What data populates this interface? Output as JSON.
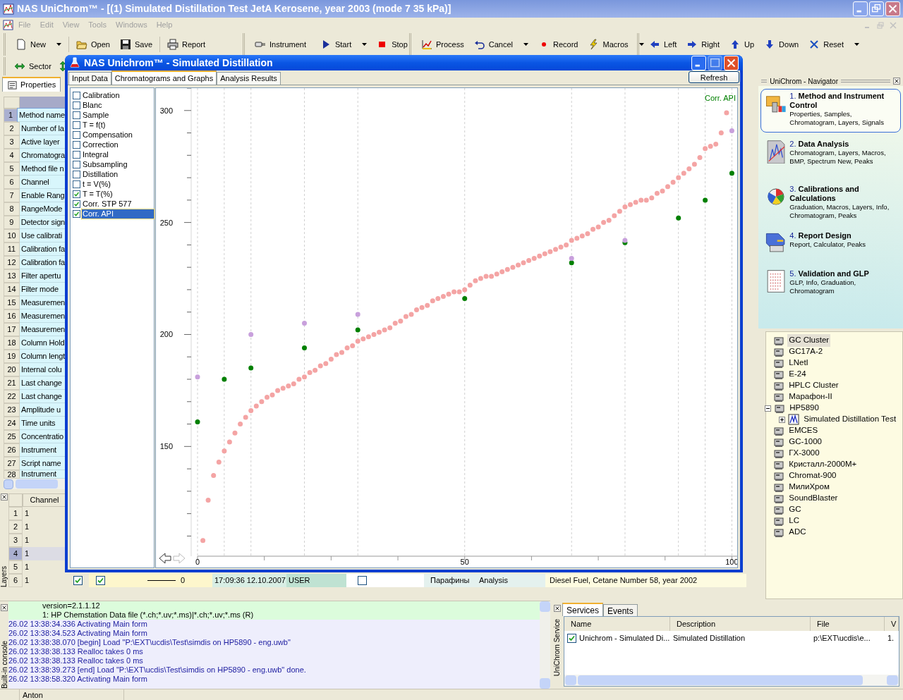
{
  "window": {
    "title": "NAS UniChrom™ - [(1) Simulated Distillation Test JetA Kerosene, year 2003 (mode 7 35 kPa)]"
  },
  "menu": [
    "File",
    "Edit",
    "View",
    "Tools",
    "Windows",
    "Help"
  ],
  "toolbars": [
    [
      [
        {
          "label": "New",
          "dropdown": true
        }
      ],
      [
        {
          "label": "Open",
          "dropdown": false
        },
        {
          "label": "Save",
          "dropdown": false
        }
      ],
      [
        {
          "label": "Report",
          "dropdown": false
        }
      ]
    ],
    [
      [
        {
          "label": "Instrument",
          "dropdown": false
        }
      ],
      [
        {
          "label": "Start",
          "dropdown": true
        },
        {
          "label": "Stop",
          "dropdown": false
        }
      ]
    ],
    [
      [
        {
          "label": "Process",
          "dropdown": false
        },
        {
          "label": "Cancel",
          "dropdown": true
        },
        {
          "label": "Record",
          "dropdown": false
        },
        {
          "label": "Macros",
          "dropdown": true
        }
      ]
    ],
    [
      [
        {
          "label": "Left",
          "dropdown": false
        },
        {
          "label": "Right",
          "dropdown": false
        },
        {
          "label": "Up",
          "dropdown": false
        },
        {
          "label": "Down",
          "dropdown": false
        },
        {
          "label": "Reset",
          "dropdown": true
        }
      ]
    ]
  ],
  "toolbar_2": [
    {
      "label": "Sector"
    }
  ],
  "properties_panel": {
    "tab": "Properties",
    "rows": [
      {
        "number": "1",
        "name": "Method name",
        "selected": true
      },
      {
        "number": "2",
        "name": "Number of la",
        "selected": false
      },
      {
        "number": "3",
        "name": "Active layer",
        "selected": false
      },
      {
        "number": "4",
        "name": "Chromatogra",
        "selected": false
      },
      {
        "number": "5",
        "name": "Method file n",
        "selected": false
      },
      {
        "number": "6",
        "name": "Channel",
        "selected": false
      },
      {
        "number": "7",
        "name": "Enable Rang",
        "selected": false
      },
      {
        "number": "8",
        "name": "RangeMode",
        "selected": false
      },
      {
        "number": "9",
        "name": "Detector sign",
        "selected": false
      },
      {
        "number": "10",
        "name": "Use calibrati",
        "selected": false
      },
      {
        "number": "11",
        "name": "Calibration fa",
        "selected": false
      },
      {
        "number": "12",
        "name": "Calibration fa",
        "selected": false
      },
      {
        "number": "13",
        "name": "Filter apertu",
        "selected": false
      },
      {
        "number": "14",
        "name": "Filter mode",
        "selected": false
      },
      {
        "number": "15",
        "name": "Measuremen",
        "selected": false
      },
      {
        "number": "16",
        "name": "Measuremen",
        "selected": false
      },
      {
        "number": "17",
        "name": "Measuremen",
        "selected": false
      },
      {
        "number": "18",
        "name": "Column Hold",
        "selected": false
      },
      {
        "number": "19",
        "name": "Column lengt",
        "selected": false
      },
      {
        "number": "20",
        "name": "Internal colu",
        "selected": false
      },
      {
        "number": "21",
        "name": "Last change",
        "selected": false
      },
      {
        "number": "22",
        "name": "Last change",
        "selected": false
      },
      {
        "number": "23",
        "name": "Amplitude u",
        "selected": false
      },
      {
        "number": "24",
        "name": "Time units",
        "selected": false
      },
      {
        "number": "25",
        "name": "Concentratio",
        "selected": false
      },
      {
        "number": "26",
        "name": "Instrument",
        "selected": false
      },
      {
        "number": "27",
        "name": "Script name",
        "selected": false
      },
      {
        "number": "28",
        "name": "Instrument",
        "selected": false
      }
    ]
  },
  "layers": {
    "label": "Layers",
    "column": "Channel",
    "rows": [
      {
        "number": "1",
        "channel": "1",
        "selected": false
      },
      {
        "number": "2",
        "channel": "1",
        "selected": false
      },
      {
        "number": "3",
        "channel": "1",
        "selected": false
      },
      {
        "number": "4",
        "channel": "1",
        "selected": true
      },
      {
        "number": "5",
        "channel": "1",
        "selected": false
      },
      {
        "number": "6",
        "channel": "1",
        "selected": false
      }
    ],
    "row_6_details": {
      "checks": [
        true,
        true
      ],
      "line_value": "0",
      "date": "17:09:36 12.10.2007",
      "user": "USER",
      "flag": false,
      "group": "Парафины",
      "type": "Analysis",
      "description": "Diesel Fuel, Cetane Number 58, year 2002"
    }
  },
  "child_window": {
    "title": "NAS Unichrom™ - Simulated Distillation",
    "tabs": [
      {
        "label": "Input Data",
        "selected": false
      },
      {
        "label": "Chromatograms and Graphs",
        "selected": true
      },
      {
        "label": "Analysis Results",
        "selected": false
      }
    ],
    "refresh_button": "Refresh",
    "graph_list": [
      {
        "label": "Calibration",
        "checked": false,
        "selected": false
      },
      {
        "label": "Blanc",
        "checked": false,
        "selected": false
      },
      {
        "label": "Sample",
        "checked": false,
        "selected": false
      },
      {
        "label": "T = f(t)",
        "checked": false,
        "selected": false
      },
      {
        "label": "Compensation",
        "checked": false,
        "selected": false
      },
      {
        "label": "Correction",
        "checked": false,
        "selected": false
      },
      {
        "label": "Integral",
        "checked": false,
        "selected": false
      },
      {
        "label": "Subsampling",
        "checked": false,
        "selected": false
      },
      {
        "label": "Distillation",
        "checked": false,
        "selected": false
      },
      {
        "label": "t = V(%)",
        "checked": false,
        "selected": false
      },
      {
        "label": "T = T(%)",
        "checked": true,
        "selected": false
      },
      {
        "label": "Corr. STP 577",
        "checked": true,
        "selected": false
      },
      {
        "label": "Corr. API",
        "checked": true,
        "selected": true
      }
    ],
    "chart_data": {
      "type": "scatter",
      "xlim": [
        0,
        101
      ],
      "ylim": [
        101,
        310
      ],
      "xticks": [
        0,
        50,
        100
      ],
      "yticks": [
        150,
        200,
        250,
        300
      ],
      "x": [
        0,
        1,
        2,
        3,
        4,
        5,
        6,
        7,
        8,
        9,
        10,
        11,
        12,
        13,
        14,
        15,
        16,
        17,
        18,
        19,
        20,
        21,
        22,
        23,
        24,
        25,
        26,
        27,
        28,
        29,
        30,
        31,
        32,
        33,
        34,
        35,
        36,
        37,
        38,
        39,
        40,
        41,
        42,
        43,
        44,
        45,
        46,
        47,
        48,
        49,
        50,
        51,
        52,
        53,
        54,
        55,
        56,
        57,
        58,
        59,
        60,
        61,
        62,
        63,
        64,
        65,
        66,
        67,
        68,
        69,
        70,
        71,
        72,
        73,
        74,
        75,
        76,
        77,
        78,
        79,
        80,
        81,
        82,
        83,
        84,
        85,
        86,
        87,
        88,
        89,
        90,
        91,
        92,
        93,
        94,
        95,
        96,
        97,
        98,
        99,
        100
      ],
      "series": [
        {
          "color": "#f4a4a4",
          "values": [
            null,
            108,
            126,
            137,
            143,
            148,
            152,
            156,
            160,
            163,
            166,
            168,
            170,
            172,
            173,
            175,
            176,
            177,
            178,
            180,
            181,
            183,
            184,
            186,
            187,
            189,
            191,
            192,
            194,
            195,
            197,
            198,
            199,
            200,
            201,
            202,
            203,
            205,
            206,
            208,
            209,
            211,
            212,
            213,
            215,
            216,
            217,
            218,
            219,
            219,
            220,
            222,
            224,
            225,
            226,
            226,
            227,
            228,
            229,
            230,
            231,
            232,
            233,
            234,
            235,
            236,
            237,
            238,
            239,
            240,
            242,
            243,
            244,
            245,
            247,
            248,
            250,
            251,
            253,
            255,
            257,
            258,
            259,
            260,
            260,
            261,
            263,
            264,
            266,
            268,
            270,
            272,
            274,
            276,
            279,
            283,
            284,
            285,
            290,
            299,
            null
          ]
        },
        {
          "name": "Corr. API",
          "color": "#008000",
          "values": [
            161,
            null,
            null,
            null,
            null,
            180,
            null,
            null,
            null,
            null,
            185,
            null,
            null,
            null,
            null,
            null,
            null,
            null,
            null,
            null,
            194,
            null,
            null,
            null,
            null,
            null,
            null,
            null,
            null,
            null,
            202,
            null,
            null,
            null,
            null,
            null,
            null,
            null,
            null,
            null,
            null,
            null,
            null,
            null,
            null,
            null,
            null,
            null,
            null,
            null,
            216,
            null,
            null,
            null,
            null,
            null,
            null,
            null,
            null,
            null,
            null,
            null,
            null,
            null,
            null,
            null,
            null,
            null,
            null,
            null,
            232,
            null,
            null,
            null,
            null,
            null,
            null,
            null,
            null,
            null,
            241,
            null,
            null,
            null,
            null,
            null,
            null,
            null,
            null,
            null,
            252,
            null,
            null,
            null,
            null,
            260,
            null,
            null,
            null,
            null,
            272
          ]
        },
        {
          "color": "#c8a0dc",
          "values": [
            181,
            null,
            null,
            null,
            null,
            null,
            null,
            null,
            null,
            null,
            200,
            null,
            null,
            null,
            null,
            null,
            null,
            null,
            null,
            null,
            205,
            null,
            null,
            null,
            null,
            null,
            null,
            null,
            null,
            null,
            209,
            null,
            null,
            null,
            null,
            null,
            null,
            null,
            null,
            null,
            null,
            null,
            null,
            null,
            null,
            null,
            null,
            null,
            null,
            null,
            null,
            null,
            null,
            null,
            null,
            null,
            null,
            null,
            null,
            null,
            null,
            null,
            null,
            null,
            null,
            null,
            null,
            null,
            null,
            null,
            234,
            null,
            null,
            null,
            null,
            null,
            null,
            null,
            null,
            null,
            242,
            null,
            null,
            null,
            null,
            null,
            null,
            null,
            null,
            null,
            null,
            null,
            null,
            null,
            null,
            null,
            null,
            null,
            null,
            null,
            291
          ]
        }
      ]
    }
  },
  "navigator": {
    "title": "UniChrom - Navigator",
    "items": [
      {
        "number": "1.",
        "title": "Method and Instrument Control",
        "subtitle": "Properties, Samples, Chromatogram, Layers, Signals",
        "selected": true
      },
      {
        "number": "2.",
        "title": "Data Analysis",
        "subtitle": "Chromatogram, Layers, Macros, BMP, Spectrum New, Peaks",
        "selected": false
      },
      {
        "number": "3.",
        "title": "Calibrations and Calculations",
        "subtitle": "Graduation, Macros, Layers, Info, Chromatogram, Peaks",
        "selected": false
      },
      {
        "number": "4.",
        "title": "Report Design",
        "subtitle": "Report, Calculator, Peaks",
        "selected": false
      },
      {
        "number": "5.",
        "title": "Validation and GLP",
        "subtitle": "GLP, Info, Graduation, Chromatogram",
        "selected": false
      }
    ],
    "tree": [
      {
        "label": "GC Cluster",
        "selected": true
      },
      {
        "label": "GC17A-2",
        "selected": false
      },
      {
        "label": "LNetI",
        "selected": false
      },
      {
        "label": "E-24",
        "selected": false
      },
      {
        "label": "HPLC Cluster",
        "selected": false
      },
      {
        "label": "Марафон-II",
        "selected": false
      },
      {
        "label": "HP5890",
        "selected": false,
        "expanded": true,
        "children": [
          {
            "label": "Simulated Distillation Test",
            "selected": false,
            "expanded": false
          }
        ]
      },
      {
        "label": "EMCES",
        "selected": false
      },
      {
        "label": "GC-1000",
        "selected": false
      },
      {
        "label": "ГХ-3000",
        "selected": false
      },
      {
        "label": "Кристалл-2000М+",
        "selected": false
      },
      {
        "label": "Chromat-900",
        "selected": false
      },
      {
        "label": "МилиХром",
        "selected": false
      },
      {
        "label": "SoundBlaster",
        "selected": false
      },
      {
        "label": "GC",
        "selected": false
      },
      {
        "label": "LC",
        "selected": false
      },
      {
        "label": "ADC",
        "selected": false
      }
    ]
  },
  "console": {
    "label": "Built-in console",
    "lines": [
      {
        "kind": "info",
        "text": "version=2.1.1.12"
      },
      {
        "kind": "info",
        "text": "1: HP Chemstation Data file (*.ch;*.uv;*.ms)|*.ch;*.uv;*.ms (R)"
      },
      {
        "kind": "log",
        "text": "26.02 13:38:34.336 Activating Main form"
      },
      {
        "kind": "log",
        "text": "26.02 13:38:34.523 Activating Main form"
      },
      {
        "kind": "log",
        "text": "26.02 13:38:38.070 [begin] Load \"P:\\EXT\\ucdis\\Test\\simdis on HP5890 - eng.uwb\""
      },
      {
        "kind": "log",
        "text": "26.02 13:38:38.133 Realloc takes 0 ms"
      },
      {
        "kind": "log",
        "text": "26.02 13:38:38.133 Realloc takes 0 ms"
      },
      {
        "kind": "log",
        "text": "26.02 13:38:39.273 [end] Load \"P:\\EXT\\ucdis\\Test\\simdis on HP5890 - eng.uwb\" done."
      },
      {
        "kind": "log",
        "text": "26.02 13:38:58.320 Activating Main form"
      }
    ]
  },
  "services": {
    "label": "UniChrom Service",
    "tabs": [
      {
        "label": "Services",
        "selected": true
      },
      {
        "label": "Events",
        "selected": false
      }
    ],
    "columns": [
      "Name",
      "Description",
      "File",
      "V"
    ],
    "rows": [
      {
        "checked": true,
        "cells": [
          "Unichrom - Simulated Di...",
          "Simulated Distillation",
          "p:\\EXT\\ucdis\\e...",
          "1."
        ]
      }
    ]
  },
  "status_bar": [
    "Anton"
  ]
}
